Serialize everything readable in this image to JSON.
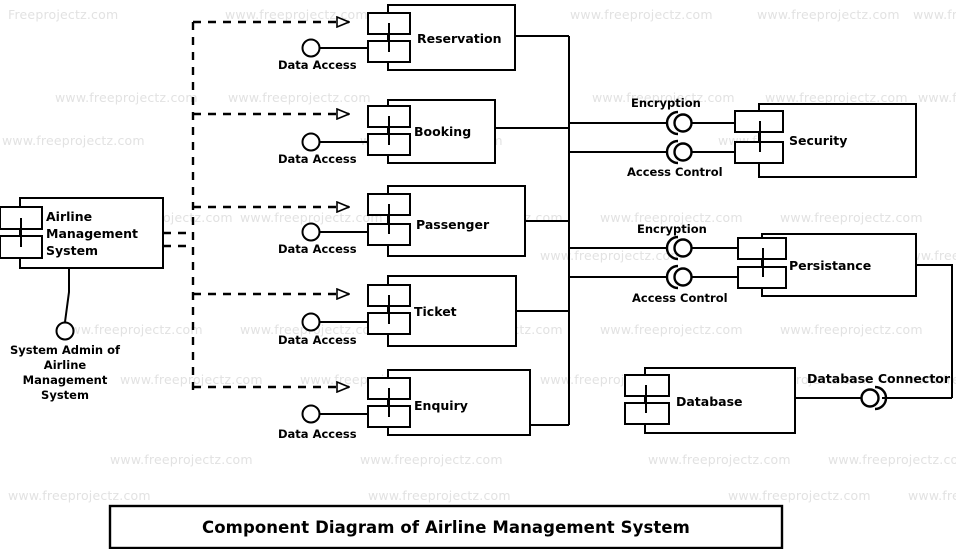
{
  "diagram": {
    "title": "Component Diagram of Airline Management System",
    "system": {
      "name": "Airline Management System",
      "actor_label": "System Admin of Airline Management System"
    },
    "components": [
      {
        "name": "Reservation",
        "interface": "Data Access"
      },
      {
        "name": "Booking",
        "interface": "Data Access"
      },
      {
        "name": "Passenger",
        "interface": "Data Access"
      },
      {
        "name": "Ticket",
        "interface": "Data Access"
      },
      {
        "name": "Enquiry",
        "interface": "Data Access"
      }
    ],
    "services": [
      {
        "name": "Security",
        "interfaces": [
          "Encryption",
          "Access Control"
        ]
      },
      {
        "name": "Persistance",
        "interfaces": [
          "Encryption",
          "Access Control"
        ]
      }
    ],
    "database": {
      "name": "Database",
      "connector": "Database Connector"
    },
    "icons": {
      "component_tab": "component-tab-icon",
      "provided_interface": "lollipop-interface-icon",
      "assembly_connector": "ball-and-socket-connector-icon",
      "realization_arrow": "hollow-triangle-arrow-icon",
      "actor_endpoint": "actor-circle-icon"
    },
    "colors": {
      "stroke": "#000000",
      "background": "#ffffff",
      "watermark": "#e2e2e2"
    }
  },
  "watermark": {
    "text": "www.freeprojectz.com",
    "short_text": "Freeprojectz.com"
  }
}
